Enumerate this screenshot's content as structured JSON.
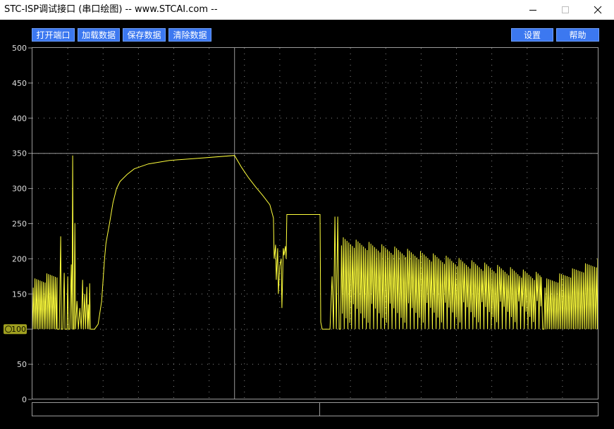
{
  "window": {
    "title": "STC-ISP调试接口 (串口绘图) -- www.STCAI.com --"
  },
  "toolbar": {
    "open_port": "打开端口",
    "load_data": "加载数据",
    "save_data": "保存数据",
    "clear_data": "清除数据",
    "settings": "设置",
    "help": "帮助"
  },
  "icons": {
    "minimize": "minimize-icon",
    "maximize": "maximize-icon",
    "close": "close-icon",
    "channel": "channel-marker-icon"
  },
  "colors": {
    "background": "#000000",
    "trace": "#ffff3c",
    "grid": "#9a9a9a",
    "button": "#3c78f0",
    "marker": "#a0a020"
  },
  "chart_data": {
    "type": "line",
    "yticks": [
      0,
      50,
      100,
      150,
      200,
      250,
      300,
      350,
      400,
      450,
      500
    ],
    "ylim": [
      0,
      500
    ],
    "xlim": [
      0,
      800
    ],
    "cursor": {
      "x": 286,
      "y": 350
    },
    "marker_value": "100",
    "grid": true,
    "series": [
      {
        "segments": [
          {
            "kind": "osc",
            "x0": 0,
            "x1": 35,
            "base": 100,
            "top": [
              165,
              180
            ],
            "period": 2.4
          },
          {
            "kind": "poly",
            "points": [
              [
                35,
                100
              ],
              [
                38,
                100
              ],
              [
                40,
                232
              ],
              [
                41,
                100
              ],
              [
                43,
                100
              ],
              [
                45,
                180
              ],
              [
                46,
                100
              ],
              [
                49,
                100
              ],
              [
                50,
                175
              ],
              [
                51,
                100
              ],
              [
                53,
                100
              ],
              [
                55,
                192
              ],
              [
                56,
                100
              ],
              [
                57,
                347
              ],
              [
                58,
                100
              ],
              [
                59,
                100
              ],
              [
                60,
                251
              ],
              [
                61,
                100
              ],
              [
                63,
                140
              ],
              [
                65,
                100
              ],
              [
                67,
                130
              ],
              [
                69,
                100
              ],
              [
                71,
                170
              ],
              [
                72,
                100
              ],
              [
                74,
                150
              ],
              [
                75,
                100
              ],
              [
                77,
                160
              ],
              [
                78,
                100
              ],
              [
                79,
                135
              ],
              [
                80,
                100
              ],
              [
                81,
                165
              ],
              [
                82,
                100
              ],
              [
                88,
                100
              ]
            ]
          },
          {
            "kind": "poly",
            "points": [
              [
                88,
                100
              ],
              [
                93,
                107
              ],
              [
                98,
                140
              ],
              [
                102,
                200
              ],
              [
                104,
                222
              ],
              [
                109,
                250
              ],
              [
                114,
                280
              ],
              [
                119,
                300
              ],
              [
                124,
                310
              ],
              [
                134,
                320
              ],
              [
                144,
                328
              ],
              [
                164,
                335
              ],
              [
                194,
                340
              ],
              [
                234,
                343
              ],
              [
                286,
                347
              ]
            ]
          },
          {
            "kind": "poly",
            "points": [
              [
                286,
                347
              ],
              [
                296,
                330
              ],
              [
                306,
                315
              ],
              [
                316,
                302
              ],
              [
                326,
                290
              ],
              [
                336,
                277
              ],
              [
                341,
                258
              ],
              [
                342,
                200
              ],
              [
                344,
                220
              ],
              [
                345,
                170
              ],
              [
                347,
                215
              ],
              [
                348,
                150
              ],
              [
                350,
                190
              ],
              [
                352,
                200
              ],
              [
                353,
                130
              ],
              [
                355,
                215
              ],
              [
                356,
                205
              ],
              [
                358,
                218
              ],
              [
                359,
                200
              ],
              [
                360,
                263
              ],
              [
                407,
                263
              ],
              [
                408,
                110
              ],
              [
                410,
                100
              ],
              [
                421,
                100
              ],
              [
                424,
                175
              ],
              [
                426,
                100
              ],
              [
                428,
                260
              ],
              [
                430,
                100
              ],
              [
                432,
                260
              ],
              [
                434,
                100
              ],
              [
                436,
                100
              ]
            ]
          },
          {
            "kind": "osc",
            "x0": 436,
            "x1": 720,
            "base": 100,
            "top": [
              225,
              174
            ],
            "mid": [
              135,
              140
            ],
            "period": 2.6
          },
          {
            "kind": "poly",
            "points": [
              [
                720,
                174
              ],
              [
                722,
                100
              ],
              [
                724,
                100
              ]
            ]
          },
          {
            "kind": "osc",
            "x0": 724,
            "x1": 800,
            "base": 100,
            "top": [
              165,
              195
            ],
            "period": 2.6
          }
        ]
      }
    ]
  }
}
